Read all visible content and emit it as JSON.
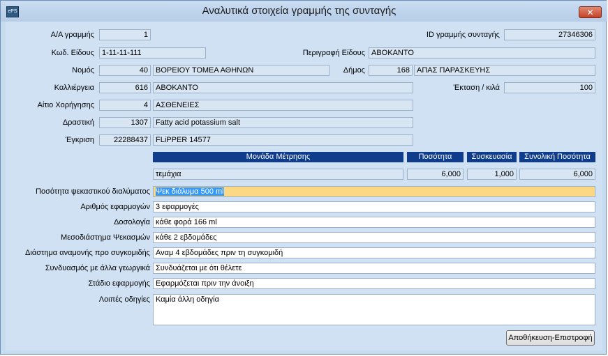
{
  "window": {
    "title": "Αναλυτικά στοιχεία γραμμής της συνταγής",
    "close_glyph": "✕",
    "app_icon_text": "ePS"
  },
  "form": {
    "line_no": {
      "label": "Α/Α γραμμής",
      "value": "1"
    },
    "line_id": {
      "label": "ID γραμμής συνταγής",
      "value": "27346306"
    },
    "item_code": {
      "label": "Κωδ. Είδους",
      "value": "1-11-11-111"
    },
    "item_desc": {
      "label": "Περιγραφή Είδους",
      "value": "ΑΒΟΚΑΝΤΟ"
    },
    "prefecture": {
      "label": "Νομός",
      "code": "40",
      "name": "ΒΟΡΕΙΟΥ ΤΟΜΕΑ ΑΘΗΝΩΝ"
    },
    "municipality": {
      "label": "Δήμος",
      "code": "168",
      "name": "ΑΠΑΣ ΠΑΡΑΣΚΕΥΗΣ"
    },
    "crop": {
      "label": "Καλλιέργεια",
      "code": "616",
      "name": "ΑΒΟΚΑΝΤΟ"
    },
    "area": {
      "label": "Έκταση / κιλά",
      "value": "100"
    },
    "reason": {
      "label": "Αίτιο Χορήγησης",
      "code": "4",
      "name": "ΑΣΘΕΝΕΙΕΣ"
    },
    "active": {
      "label": "Δραστική",
      "code": "1307",
      "name": "Fatty acid potassium salt"
    },
    "approval": {
      "label": "Έγκριση",
      "code": "22288437",
      "name": "FLiPPER 14577"
    }
  },
  "measure_table": {
    "headers": {
      "unit": "Μονάδα Μέτρησης",
      "quantity": "Ποσότητα",
      "package": "Συσκευασία",
      "total": "Συνολική Ποσότητα"
    },
    "row": {
      "unit": "τεμάχια",
      "quantity": "6,000",
      "package": "1,000",
      "total": "6,000"
    }
  },
  "instructions": {
    "spray_qty": {
      "label": "Ποσότητα ψεκαστικού διαλύματος",
      "value": "Ψεκ διάλυμα 500 ml"
    },
    "applications": {
      "label": "Αριθμός εφαρμογών",
      "value": "3 εφαρμογές"
    },
    "dosage": {
      "label": "Δοσολογία",
      "value": "κάθε φορά 166 ml"
    },
    "interval": {
      "label": "Μεσοδιάστημα Ψεκασμών",
      "value": "κάθε 2 εβδομάδες"
    },
    "pre_harvest": {
      "label": "Διάστημα αναμονής προ συγκομιδής",
      "value": "Αναμ 4 εβδομάδες πριν τη συγκομιδή"
    },
    "combination": {
      "label": "Συνδυασμός με άλλα γεωργικά",
      "value": "Συνδυάζεται με ότι θέλετε"
    },
    "stage": {
      "label": "Στάδιο εφαρμογής",
      "value": "Εφαρμόζεται πριν την άνοιξη"
    },
    "other": {
      "label": "Λοιπές οδηγίες",
      "value": "Καμία άλλη οδηγία"
    }
  },
  "buttons": {
    "save_return": "Αποθήκευση-Επιστροφή"
  }
}
